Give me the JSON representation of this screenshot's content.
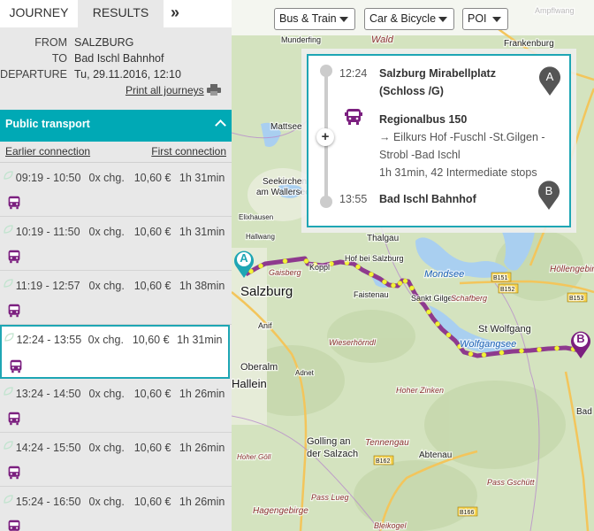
{
  "tabs": [
    {
      "label": "JOURNEY"
    },
    {
      "label": "RESULTS"
    },
    {
      "label": "»"
    }
  ],
  "journey": {
    "from_label": "FROM",
    "from": "SALZBURG",
    "to_label": "TO",
    "to": "Bad Ischl Bahnhof",
    "departure_label": "DEPARTURE",
    "departure": "Tu, 29.11.2016, 12:10",
    "print_label": "Print all journeys"
  },
  "section": {
    "title": "Public transport",
    "earlier": "Earlier connection",
    "first": "First connection"
  },
  "results": [
    {
      "time": "09:19 - 10:50",
      "changes": "0x chg.",
      "price": "10,60 €",
      "duration": "1h 31min"
    },
    {
      "time": "10:19 - 11:50",
      "changes": "0x chg.",
      "price": "10,60 €",
      "duration": "1h 31min"
    },
    {
      "time": "11:19 - 12:57",
      "changes": "0x chg.",
      "price": "10,60 €",
      "duration": "1h 38min"
    },
    {
      "time": "12:24 - 13:55",
      "changes": "0x chg.",
      "price": "10,60 €",
      "duration": "1h 31min",
      "selected": true
    },
    {
      "time": "13:24 - 14:50",
      "changes": "0x chg.",
      "price": "10,60 €",
      "duration": "1h 26min"
    },
    {
      "time": "14:24 - 15:50",
      "changes": "0x chg.",
      "price": "10,60 €",
      "duration": "1h 26min"
    },
    {
      "time": "15:24 - 16:50",
      "changes": "0x chg.",
      "price": "10,60 €",
      "duration": "1h 26min"
    }
  ],
  "filters": [
    {
      "label": "Bus & Train"
    },
    {
      "label": "Car & Bicycle"
    },
    {
      "label": "POI"
    }
  ],
  "popup": {
    "dep_time": "12:24",
    "dep_stop_1": "Salzburg Mirabellplatz",
    "dep_stop_2": "(Schloss /G)",
    "line": "Regionalbus 150",
    "direction_1": "→ Eilkurs Hof -Fuschl -St.Gilgen -",
    "direction_2": "Strobl -Bad Ischl",
    "summary": "1h 31min, 42 Intermediate stops",
    "arr_time": "13:55",
    "arr_stop": "Bad Ischl Bahnhof",
    "pin_a": "A",
    "pin_b": "B"
  },
  "map": {
    "pin_a": "A",
    "pin_b": "B",
    "labels": [
      {
        "text": "Munderfing"
      },
      {
        "text": "Wald"
      },
      {
        "text": "Frankenburg"
      },
      {
        "text": "Ampflwang"
      },
      {
        "text": "Mattsee"
      },
      {
        "text": "Seekirchen"
      },
      {
        "text": "am Wallersee"
      },
      {
        "text": "Elixhausen"
      },
      {
        "text": "Hallwang"
      },
      {
        "text": "Thalgau"
      },
      {
        "text": "Salzburg"
      },
      {
        "text": "Gaisberg"
      },
      {
        "text": "Koppl"
      },
      {
        "text": "Hof bei Salzburg"
      },
      {
        "text": "Faistenau"
      },
      {
        "text": "Mondsee"
      },
      {
        "text": "Sankt Gilgen"
      },
      {
        "text": "Schafberg"
      },
      {
        "text": "St Wolfgang"
      },
      {
        "text": "Wolfgangsee"
      },
      {
        "text": "Höllengebirge"
      },
      {
        "text": "Wieserhörndl"
      },
      {
        "text": "Anif"
      },
      {
        "text": "Oberalm"
      },
      {
        "text": "Hallein"
      },
      {
        "text": "Adnet"
      },
      {
        "text": "Hoher Zinken"
      },
      {
        "text": "Golling an"
      },
      {
        "text": "der Salzach"
      },
      {
        "text": "Tennengau"
      },
      {
        "text": "Abtenau"
      },
      {
        "text": "Pass Lueg"
      },
      {
        "text": "Pass Gschütt"
      },
      {
        "text": "Hagengebirge"
      },
      {
        "text": "Bleikogel"
      },
      {
        "text": "Hoher Göll"
      },
      {
        "text": "Bad"
      },
      {
        "text": "B151"
      },
      {
        "text": "B152"
      },
      {
        "text": "B153"
      },
      {
        "text": "B162"
      },
      {
        "text": "B166"
      }
    ]
  },
  "colors": {
    "accent": "#00a9b5",
    "bus": "#7b1f7f",
    "route": "#8e3a8e",
    "stop": "#f2f23a",
    "map_green": "#d4e3bf",
    "water": "#a9cff0"
  }
}
